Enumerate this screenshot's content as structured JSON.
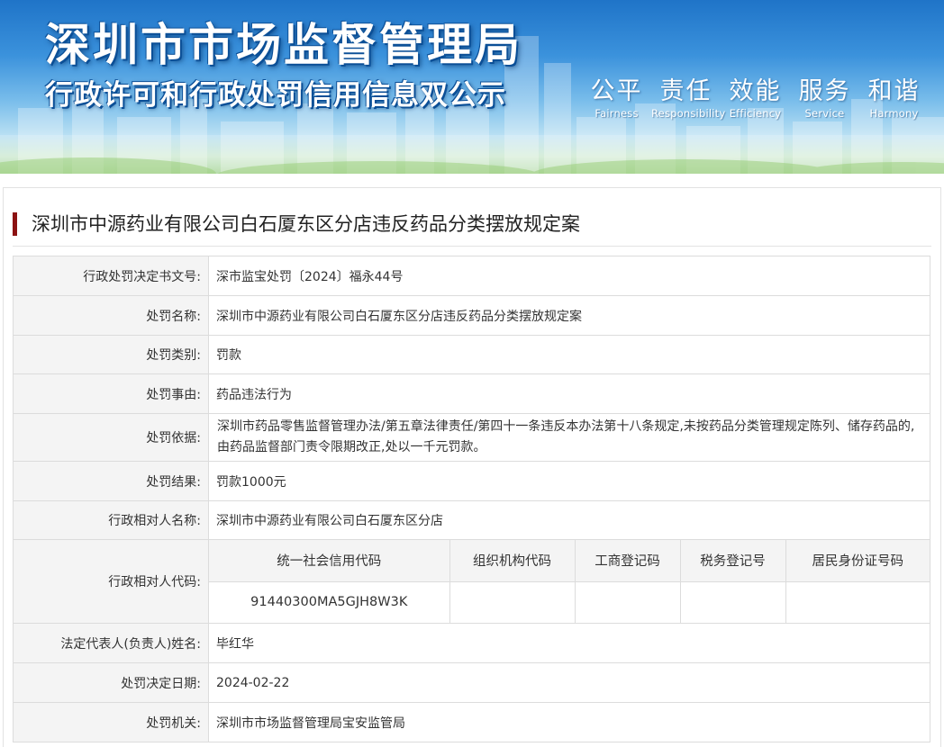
{
  "banner": {
    "title": "深圳市市场监督管理局",
    "subtitle": "行政许可和行政处罚信用信息双公示",
    "slogans": [
      {
        "cn": "公平",
        "en": "Fairness"
      },
      {
        "cn": "责任",
        "en": "Responsibility"
      },
      {
        "cn": "效能",
        "en": "Efficiency"
      },
      {
        "cn": "服务",
        "en": "Service"
      },
      {
        "cn": "和谐",
        "en": "Harmony"
      }
    ]
  },
  "page_title": "深圳市中源药业有限公司白石厦东区分店违反药品分类摆放规定案",
  "rows": {
    "decision_no": {
      "label": "行政处罚决定书文号:",
      "value": "深市监宝处罚〔2024〕福永44号"
    },
    "case_name": {
      "label": "处罚名称:",
      "value": "深圳市中源药业有限公司白石厦东区分店违反药品分类摆放规定案"
    },
    "category": {
      "label": "处罚类别:",
      "value": "罚款"
    },
    "reason": {
      "label": "处罚事由:",
      "value": "药品违法行为"
    },
    "basis": {
      "label": "处罚依据:",
      "value": "深圳市药品零售监督管理办法/第五章法律责任/第四十一条违反本办法第十八条规定,未按药品分类管理规定陈列、储存药品的,由药品监督部门责令限期改正,处以一千元罚款。"
    },
    "result": {
      "label": "处罚结果:",
      "value": "罚款1000元"
    },
    "party_name": {
      "label": "行政相对人名称:",
      "value": "深圳市中源药业有限公司白石厦东区分店"
    },
    "party_code": {
      "label": "行政相对人代码:",
      "headers": [
        "统一社会信用代码",
        "组织机构代码",
        "工商登记码",
        "税务登记号",
        "居民身份证号码"
      ],
      "values": [
        "91440300MA5GJH8W3K",
        "",
        "",
        "",
        ""
      ]
    },
    "legal_rep": {
      "label": "法定代表人(负责人)姓名:",
      "value": "毕红华"
    },
    "decision_date": {
      "label": "处罚决定日期:",
      "value": "2024-02-22"
    },
    "authority": {
      "label": "处罚机关:",
      "value": "深圳市市场监督管理局宝安监管局"
    }
  }
}
